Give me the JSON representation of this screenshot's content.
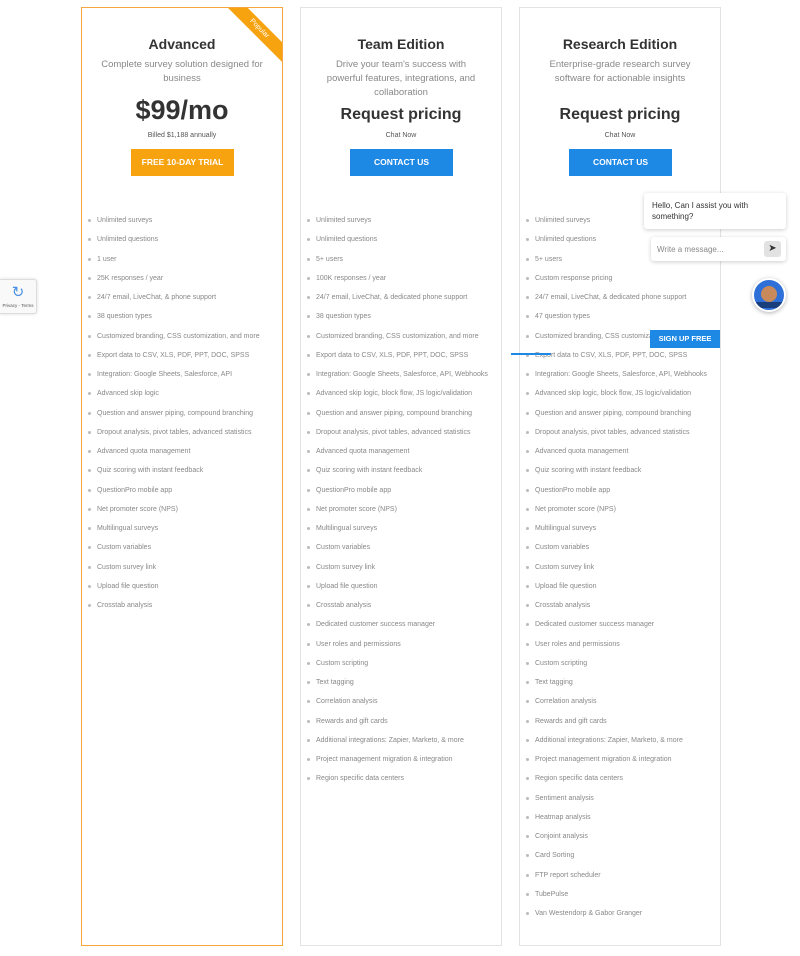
{
  "plans": [
    {
      "name": "Advanced",
      "subtitle": "Complete survey solution designed for business",
      "price": "$99/mo",
      "price_note": "Billed $1,188 annually",
      "cta": "FREE 10-DAY TRIAL",
      "ribbon": "Popular",
      "features": [
        "Unlimited surveys",
        "Unlimited questions",
        "1 user",
        "25K responses / year",
        "24/7 email, LiveChat, & phone support",
        "38 question types",
        "Customized branding, CSS customization, and more",
        "Export data to CSV, XLS, PDF, PPT, DOC, SPSS",
        "Integration: Google Sheets, Salesforce, API",
        "Advanced skip logic",
        "Question and answer piping, compound branching",
        "Dropout analysis, pivot tables, advanced statistics",
        "Advanced quota management",
        "Quiz scoring with instant feedback",
        "QuestionPro mobile app",
        "Net promoter score (NPS)",
        "Multilingual surveys",
        "Custom variables",
        "Custom survey link",
        "Upload file question",
        "Crosstab analysis"
      ]
    },
    {
      "name": "Team Edition",
      "subtitle": "Drive your team's success with powerful features, integrations, and collaboration",
      "price": "Request pricing",
      "price_note": "Chat Now",
      "cta": "CONTACT US",
      "features": [
        "Unlimited surveys",
        "Unlimited questions",
        "5+ users",
        "100K responses / year",
        "24/7 email, LiveChat, & dedicated phone support",
        "38 question types",
        "Customized branding, CSS customization, and more",
        "Export data to CSV, XLS, PDF, PPT, DOC, SPSS",
        "Integration: Google Sheets, Salesforce, API, Webhooks",
        "Advanced skip logic, block flow, JS logic/validation",
        "Question and answer piping, compound branching",
        "Dropout analysis, pivot tables, advanced statistics",
        "Advanced quota management",
        "Quiz scoring with instant feedback",
        "QuestionPro mobile app",
        "Net promoter score (NPS)",
        "Multilingual surveys",
        "Custom variables",
        "Custom survey link",
        "Upload file question",
        "Crosstab analysis",
        "Dedicated customer success manager",
        "User roles and permissions",
        "Custom scripting",
        "Text tagging",
        "Correlation analysis",
        "Rewards and gift cards",
        "Additional integrations: Zapier, Marketo, & more",
        "Project management migration & integration",
        "Region specific data centers"
      ]
    },
    {
      "name": "Research Edition",
      "subtitle": "Enterprise-grade research survey software for actionable insights",
      "price": "Request pricing",
      "price_note": "Chat Now",
      "cta": "CONTACT US",
      "features": [
        "Unlimited surveys",
        "Unlimited questions",
        "5+ users",
        "Custom response pricing",
        "24/7 email, LiveChat, & dedicated phone support",
        "47 question types",
        "Customized branding, CSS customization, and more",
        "Export data to CSV, XLS, PDF, PPT, DOC, SPSS",
        "Integration: Google Sheets, Salesforce, API, Webhooks",
        "Advanced skip logic, block flow, JS logic/validation",
        "Question and answer piping, compound branching",
        "Dropout analysis, pivot tables, advanced statistics",
        "Advanced quota management",
        "Quiz scoring with instant feedback",
        "QuestionPro mobile app",
        "Net promoter score (NPS)",
        "Multilingual surveys",
        "Custom variables",
        "Custom survey link",
        "Upload file question",
        "Crosstab analysis",
        "Dedicated customer success manager",
        "User roles and permissions",
        "Custom scripting",
        "Text tagging",
        "Correlation analysis",
        "Rewards and gift cards",
        "Additional integrations: Zapier, Marketo, & more",
        "Project management migration & integration",
        "Region specific data centers",
        "Sentiment analysis",
        "Heatmap analysis",
        "Conjoint analysis",
        "Card Sorting",
        "FTP report scheduler",
        "TubePulse",
        "Van Westendorp & Gabor Granger"
      ]
    }
  ],
  "chat": {
    "greeting": "Hello, Can I assist you with something?",
    "placeholder": "Write a message...",
    "send_icon": "send-icon"
  },
  "signup": "SIGN UP FREE",
  "recaptcha": {
    "text": "Privacy - Terms",
    "icon": "recaptcha-icon"
  },
  "colors": {
    "orange": "#f7a20f",
    "blue": "#1e88e5",
    "popular_border": "#f7a541"
  }
}
